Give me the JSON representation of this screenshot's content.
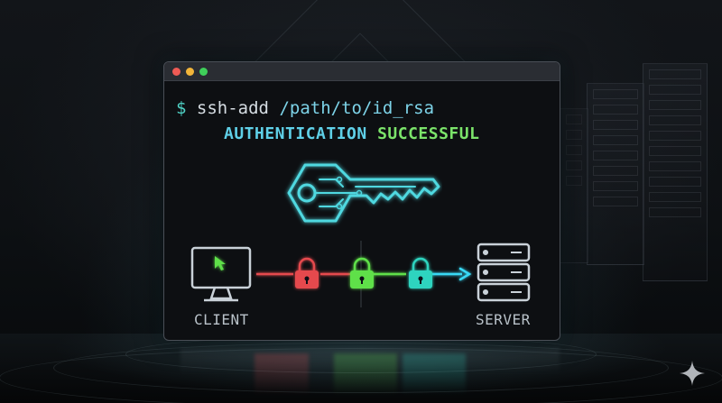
{
  "terminal": {
    "prompt_symbol": "$",
    "command": "ssh-add",
    "command_args": "/path/to/id_rsa",
    "status_word_1": "AUTHENTICATION",
    "status_word_2": "SUCCESSFUL",
    "window_buttons": [
      "close",
      "minimize",
      "maximize"
    ]
  },
  "diagram": {
    "client_label": "CLIENT",
    "server_label": "SERVER",
    "icons": [
      "monitor-icon",
      "cursor-icon",
      "padlock-icon",
      "padlock-icon",
      "padlock-icon",
      "arrow-icon",
      "server-icon"
    ]
  },
  "colors": {
    "close": "#ef5b55",
    "minimize": "#f2b53a",
    "maximize": "#3fcf5a",
    "prompt": "#4fd1c5",
    "key": "#4fd8e0",
    "lock_red": "#e5484d",
    "lock_green": "#5fe04a",
    "lock_teal": "#2dd4bf",
    "arrow": "#38d9f5"
  },
  "decor": {
    "sparkle_icon": "sparkle-icon"
  }
}
